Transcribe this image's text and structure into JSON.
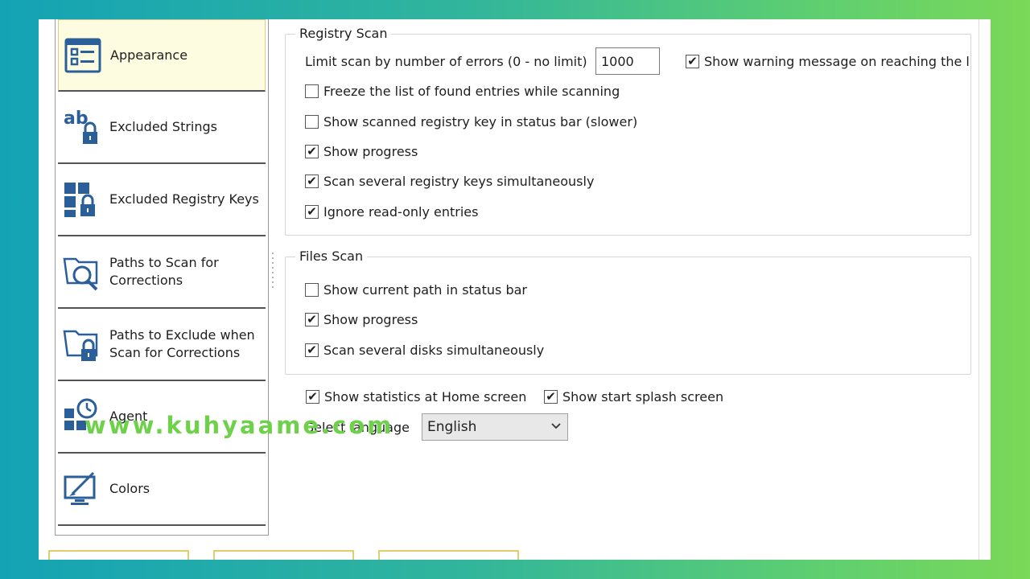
{
  "sidebar": {
    "items": [
      {
        "label": "Appearance",
        "icon": "appearance-icon",
        "active": true
      },
      {
        "label": "Excluded Strings",
        "icon": "excluded-strings-icon"
      },
      {
        "label": "Excluded Registry Keys",
        "icon": "excluded-registry-keys-icon"
      },
      {
        "label": "Paths to Scan for\nCorrections",
        "icon": "folder-search-icon"
      },
      {
        "label": "Paths to Exclude when\nScan for Corrections",
        "icon": "folder-lock-icon"
      },
      {
        "label": "Agent",
        "icon": "agent-clock-icon"
      },
      {
        "label": "Colors",
        "icon": "monitor-brush-icon"
      }
    ]
  },
  "registry_scan": {
    "title": "Registry Scan",
    "limit_label": "Limit scan by number of errors (0 - no limit)",
    "limit_value": "1000",
    "show_warning": {
      "label": "Show warning message on reaching the lir",
      "checked": true
    },
    "options": [
      {
        "label": "Freeze the list of found entries while scanning",
        "checked": false
      },
      {
        "label": "Show scanned registry key in status bar (slower)",
        "checked": false
      },
      {
        "label": "Show progress",
        "checked": true
      },
      {
        "label": "Scan several registry keys simultaneously",
        "checked": true
      },
      {
        "label": "Ignore read-only entries",
        "checked": true
      }
    ]
  },
  "files_scan": {
    "title": "Files Scan",
    "options": [
      {
        "label": "Show current path in status bar",
        "checked": false
      },
      {
        "label": "Show progress",
        "checked": true
      },
      {
        "label": "Scan several disks simultaneously",
        "checked": true
      }
    ]
  },
  "general": {
    "show_statistics": {
      "label": "Show statistics at Home screen",
      "checked": true
    },
    "show_splash": {
      "label": "Show start splash screen",
      "checked": true
    },
    "language_label": "Select language",
    "language_value": "English"
  },
  "watermark": "www.kuhyaame.com",
  "colors": {
    "active_bg": "#fdfbe0",
    "icon_blue": "#2a5f9a",
    "watermark": "#6ed14a"
  }
}
